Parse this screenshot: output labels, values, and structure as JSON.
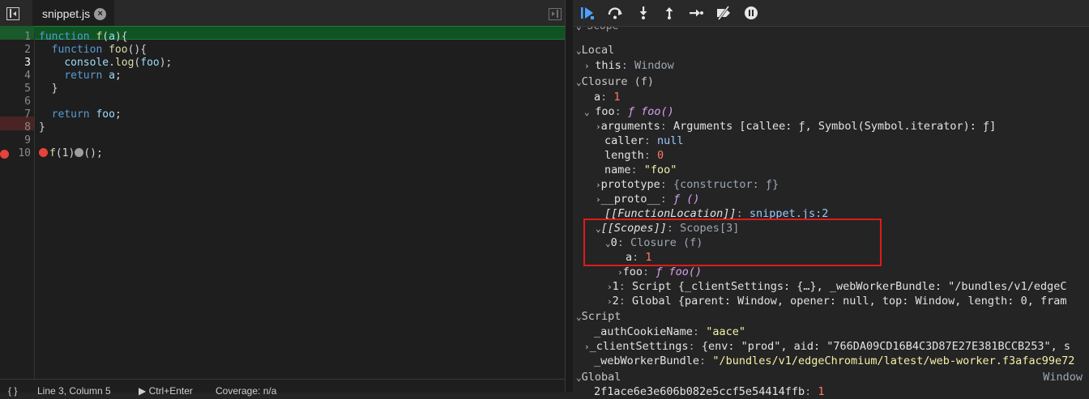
{
  "editor": {
    "tab_title": "snippet.js",
    "lines": [
      {
        "n": "1",
        "code": [
          [
            "kw",
            "function "
          ],
          [
            "fn",
            "f"
          ],
          [
            "pl",
            "("
          ],
          [
            "",
            "a"
          ],
          [
            "pl",
            "){"
          ]
        ]
      },
      {
        "n": "2",
        "code": [
          [
            "pl",
            "  "
          ],
          [
            "kw",
            "function "
          ],
          [
            "fn",
            "foo"
          ],
          [
            "pl",
            "(){"
          ]
        ]
      },
      {
        "n": "3",
        "code": [
          [
            "pl",
            "    "
          ],
          [
            "",
            "console"
          ],
          [
            "pl",
            "."
          ],
          [
            "fn",
            "log"
          ],
          [
            "pl",
            "("
          ],
          [
            "",
            "foo"
          ],
          [
            "pl",
            ");"
          ]
        ]
      },
      {
        "n": "4",
        "code": [
          [
            "pl",
            "    "
          ],
          [
            "kw",
            "return "
          ],
          [
            "",
            "a"
          ],
          [
            "pl",
            ";"
          ]
        ]
      },
      {
        "n": "5",
        "code": [
          [
            "pl",
            "  }"
          ]
        ]
      },
      {
        "n": "6",
        "code": []
      },
      {
        "n": "7",
        "code": [
          [
            "pl",
            "  "
          ],
          [
            "kw",
            "return "
          ],
          [
            "",
            "foo"
          ],
          [
            "pl",
            ";"
          ]
        ]
      },
      {
        "n": "8",
        "code": [
          [
            "pl",
            "}"
          ]
        ]
      },
      {
        "n": "9",
        "code": []
      },
      {
        "n": "10",
        "code": [
          [
            "fn",
            "f"
          ],
          [
            "pl",
            "(1)"
          ],
          [
            "pl",
            "();"
          ]
        ]
      }
    ],
    "status": {
      "braces": "{ }",
      "position": "Line 3, Column 5",
      "run": "▶ Ctrl+Enter",
      "coverage": "Coverage: n/a"
    }
  },
  "toolbar": {
    "buttons": [
      "resume-icon",
      "step-over-icon",
      "step-into-icon",
      "step-out-icon",
      "step-icon",
      "deactivate-breakpoints-icon",
      "pause-on-exceptions-icon"
    ]
  },
  "scope": {
    "header": "Scope",
    "local": "Local",
    "this_key": "this",
    "this_val": "Window",
    "closure": "Closure (f)",
    "a_key": "a",
    "a_val": "1",
    "foo_key": "foo",
    "foo_val": "ƒ foo()",
    "arguments_key": "arguments",
    "arguments_val": "Arguments [callee: ƒ, Symbol(Symbol.iterator): ƒ]",
    "caller_key": "caller",
    "caller_val": "null",
    "length_key": "length",
    "length_val": "0",
    "name_key": "name",
    "name_val": "\"foo\"",
    "prototype_key": "prototype",
    "prototype_val": "{constructor: ƒ}",
    "proto_key": "__proto__",
    "proto_val": "ƒ ()",
    "fnloc_key": "[[FunctionLocation]]",
    "fnloc_val": "snippet.js:2",
    "scopes_key": "[[Scopes]]",
    "scopes_val": "Scopes[3]",
    "s0_key": "0",
    "s0_val": "Closure (f)",
    "s0_a_key": "a",
    "s0_a_val": "1",
    "s0_foo_key": "foo",
    "s0_foo_val": "ƒ foo()",
    "s1_key": "1",
    "s1_val": "Script {_clientSettings: {…}, _webWorkerBundle: \"/bundles/v1/edgeC",
    "s2_key": "2",
    "s2_val": "Global {parent: Window, opener: null, top: Window, length: 0, fram",
    "script": "Script",
    "auth_key": "_authCookieName",
    "auth_val": "\"aace\"",
    "client_key": "_clientSettings",
    "client_val": "{env: \"prod\", aid: \"766DA09CD16B4C3D87E27E381BCCB253\", s",
    "worker_key": "_webWorkerBundle",
    "worker_val": "\"/bundles/v1/edgeChromium/latest/web-worker.f3afac99e72",
    "global": "Global",
    "global_val": "Window",
    "last_key": "2f1ace6e3e606b082e5ccf5e54414ffb",
    "last_val": "1"
  }
}
